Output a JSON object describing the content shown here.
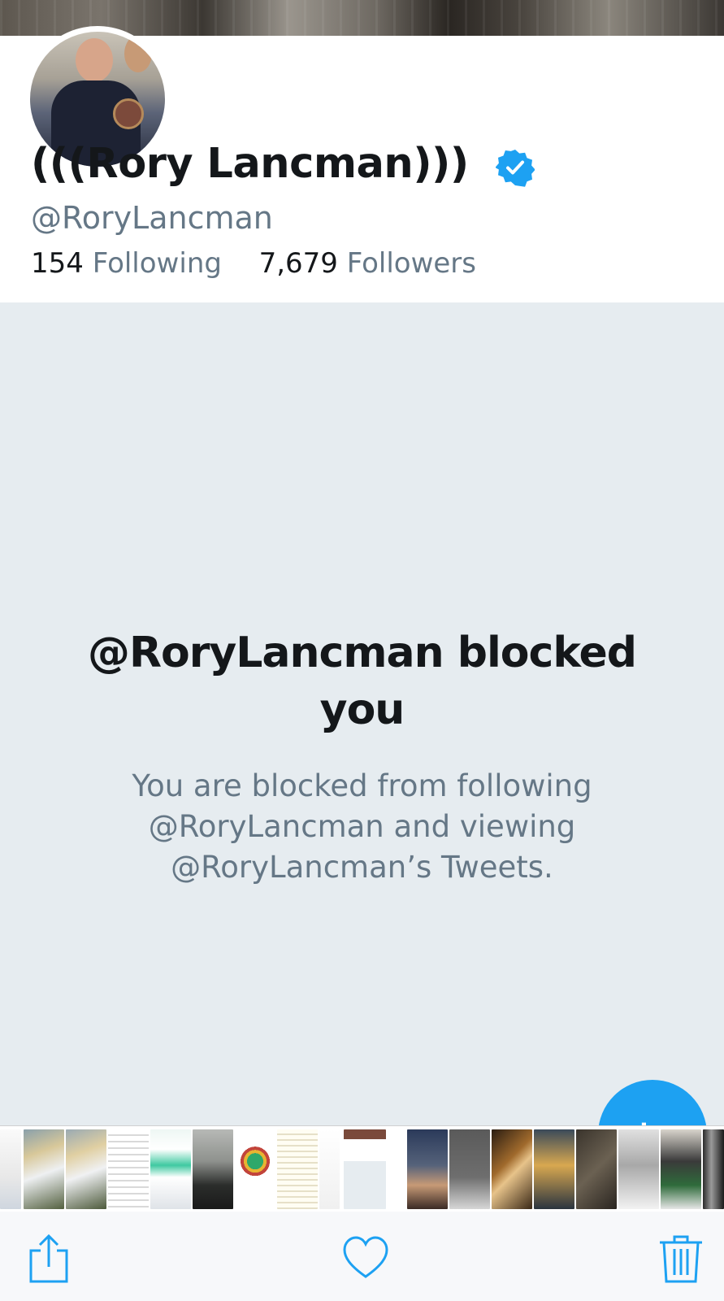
{
  "profile": {
    "display_name": "(((Rory Lancman)))",
    "verified": true,
    "handle": "@RoryLancman",
    "following_count": "154",
    "following_label": "Following",
    "followers_count": "7,679",
    "followers_label": "Followers"
  },
  "blocked": {
    "title": "@RoryLancman blocked you",
    "message": "You are blocked from following @RoryLancman and viewing @RoryLancman’s Tweets."
  },
  "colors": {
    "accent": "#1da1f2",
    "text_primary": "#14171a",
    "text_secondary": "#657786",
    "blocked_background": "#e6ecf0"
  },
  "icons": {
    "verified": "verified-badge-icon",
    "compose": "compose-tweet-icon",
    "share": "share-icon",
    "like": "heart-icon",
    "delete": "trash-icon"
  },
  "thumbnail_strip": {
    "count": 17
  }
}
